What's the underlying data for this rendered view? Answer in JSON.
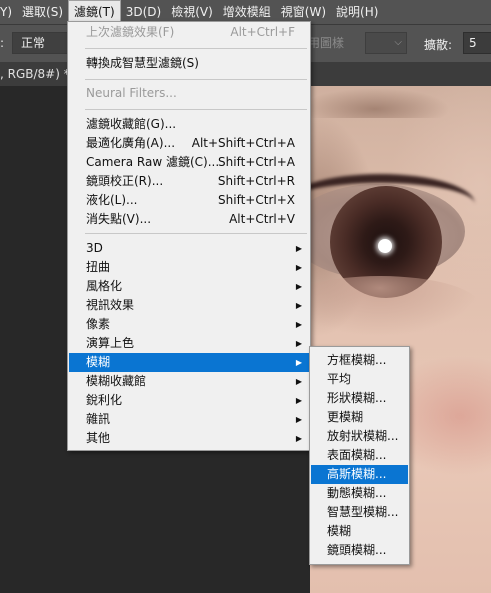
{
  "menubar": {
    "items": [
      {
        "label": "Y)",
        "active": false
      },
      {
        "label": "選取(S)",
        "active": false
      },
      {
        "label": "濾鏡(T)",
        "active": true
      },
      {
        "label": "3D(D)",
        "active": false
      },
      {
        "label": "檢視(V)",
        "active": false
      },
      {
        "label": "增效模組",
        "active": false
      },
      {
        "label": "視窗(W)",
        "active": false
      },
      {
        "label": "說明(H)",
        "active": false
      }
    ]
  },
  "options_bar": {
    "colon": ":",
    "mode_value": "正常",
    "ghost_text": "用圖樣",
    "spread_label": "擴散:",
    "spread_value": "5"
  },
  "document_tab": {
    "label": ", RGB/8#) *"
  },
  "filter_menu": {
    "items": [
      {
        "label": "上次濾鏡效果(F)",
        "shortcut": "Alt+Ctrl+F",
        "disabled": true
      },
      {
        "label": "轉換成智慧型濾鏡(S)",
        "shortcut": ""
      },
      {
        "label": "Neural Filters...",
        "shortcut": "",
        "disabled": true
      },
      {
        "label": "濾鏡收藏館(G)...",
        "shortcut": ""
      },
      {
        "label": "最適化廣角(A)...",
        "shortcut": "Alt+Shift+Ctrl+A"
      },
      {
        "label": "Camera Raw 濾鏡(C)...",
        "shortcut": "Shift+Ctrl+A"
      },
      {
        "label": "鏡頭校正(R)...",
        "shortcut": "Shift+Ctrl+R"
      },
      {
        "label": "液化(L)...",
        "shortcut": "Shift+Ctrl+X"
      },
      {
        "label": "消失點(V)...",
        "shortcut": "Alt+Ctrl+V"
      },
      {
        "label": "3D",
        "submenu": true
      },
      {
        "label": "扭曲",
        "submenu": true
      },
      {
        "label": "風格化",
        "submenu": true
      },
      {
        "label": "視訊效果",
        "submenu": true
      },
      {
        "label": "像素",
        "submenu": true
      },
      {
        "label": "演算上色",
        "submenu": true
      },
      {
        "label": "模糊",
        "submenu": true,
        "highlighted": true
      },
      {
        "label": "模糊收藏館",
        "submenu": true
      },
      {
        "label": "銳利化",
        "submenu": true
      },
      {
        "label": "雜訊",
        "submenu": true
      },
      {
        "label": "其他",
        "submenu": true
      }
    ],
    "arrow_glyph": "▶"
  },
  "blur_submenu": {
    "items": [
      {
        "label": "方框模糊..."
      },
      {
        "label": "平均"
      },
      {
        "label": "形狀模糊..."
      },
      {
        "label": "更模糊"
      },
      {
        "label": "放射狀模糊..."
      },
      {
        "label": "表面模糊..."
      },
      {
        "label": "高斯模糊...",
        "highlighted": true
      },
      {
        "label": "動態模糊..."
      },
      {
        "label": "智慧型模糊..."
      },
      {
        "label": "模糊"
      },
      {
        "label": "鏡頭模糊..."
      }
    ]
  },
  "colors": {
    "highlight": "#0a75d2",
    "menu_bg": "#f0f0f0",
    "toolbar_bg": "#535353",
    "workspace_bg": "#282828"
  }
}
